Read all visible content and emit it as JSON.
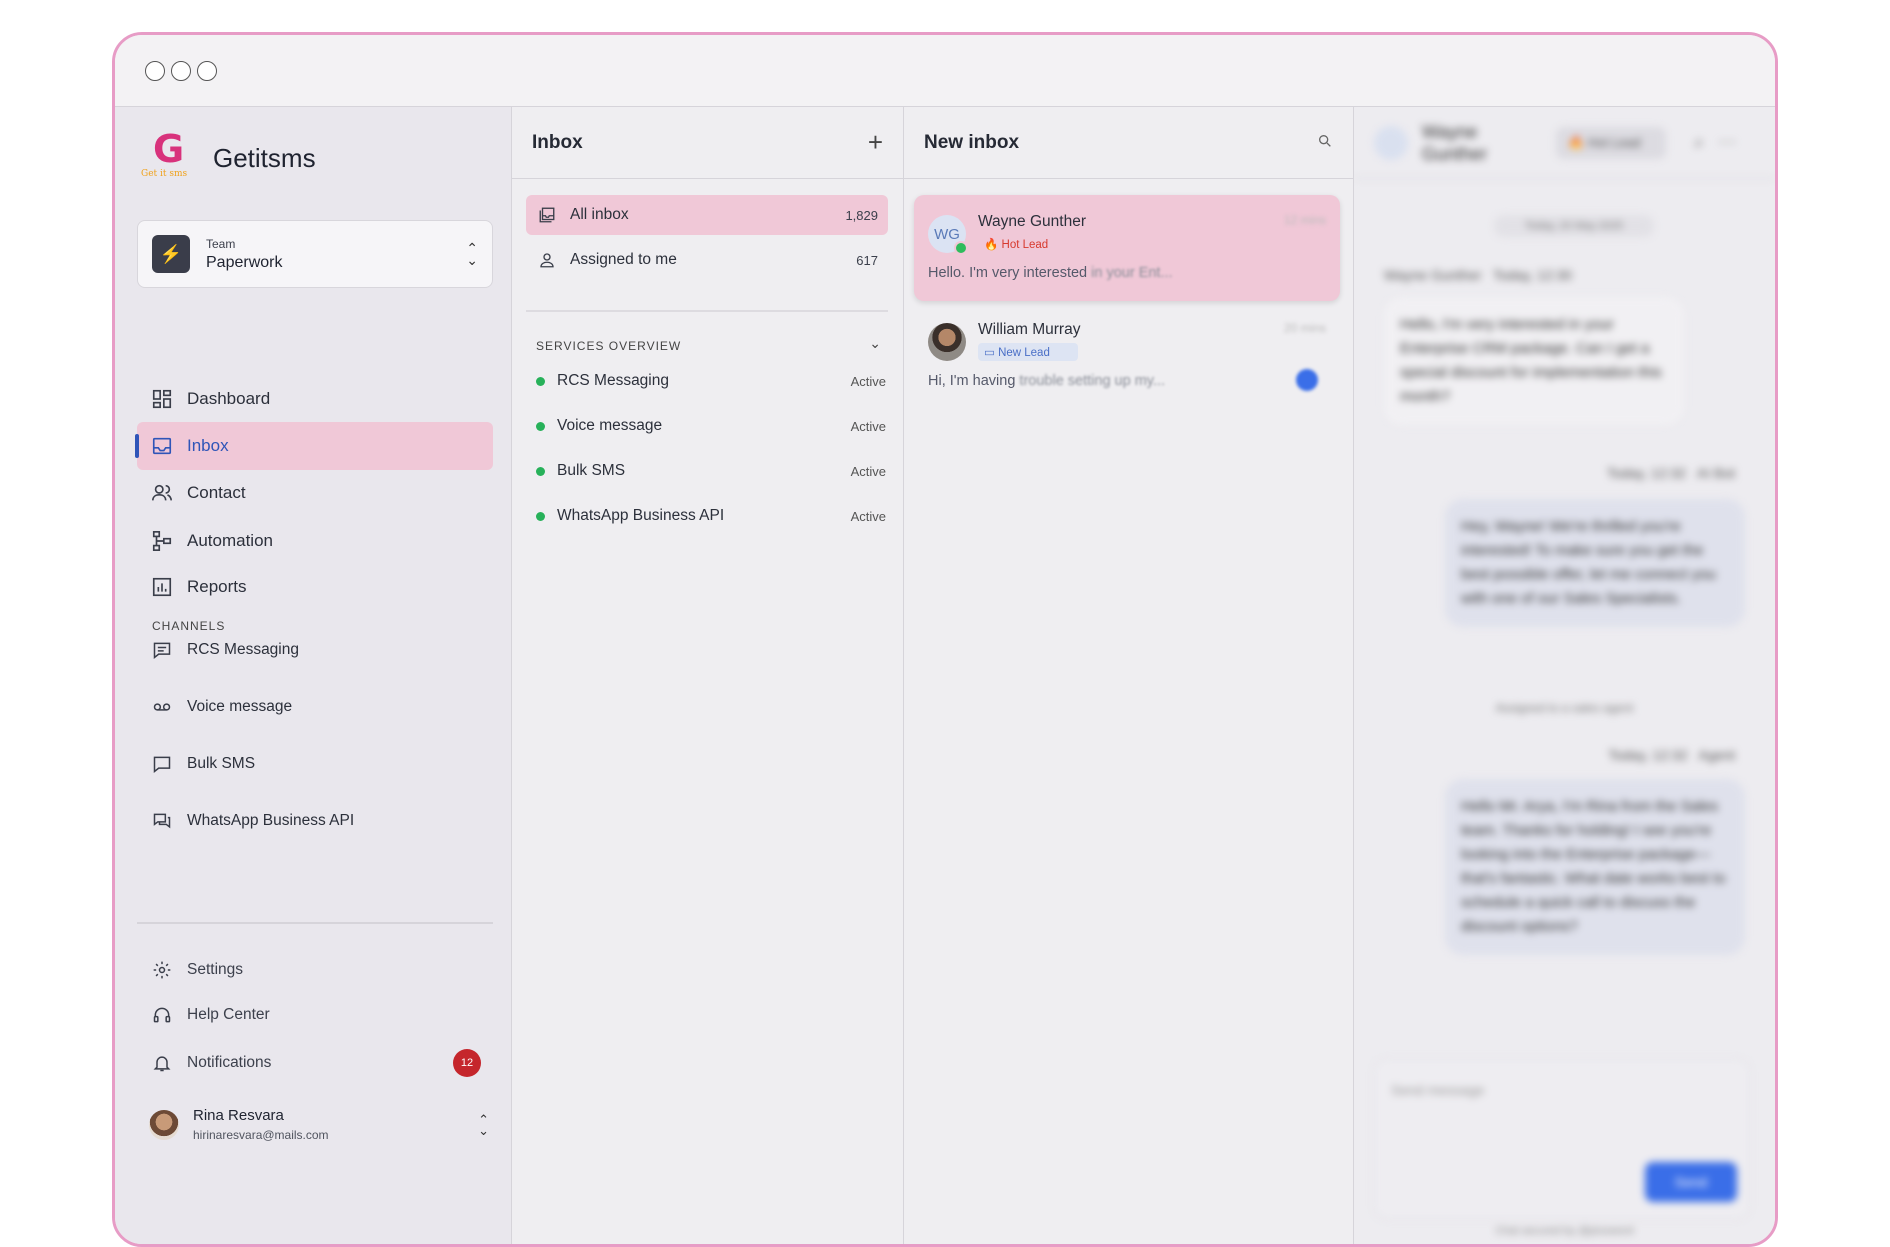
{
  "brand": {
    "name": "Getitsms",
    "logo_text": "Get it sms"
  },
  "team": {
    "label": "Team",
    "name": "Paperwork"
  },
  "nav": [
    {
      "label": "Dashboard",
      "icon": "dashboard-icon"
    },
    {
      "label": "Inbox",
      "icon": "inbox-icon",
      "active": true
    },
    {
      "label": "Contact",
      "icon": "contact-icon"
    },
    {
      "label": "Automation",
      "icon": "automation-icon"
    },
    {
      "label": "Reports",
      "icon": "reports-icon"
    }
  ],
  "channels": {
    "label": "CHANNELS",
    "items": [
      {
        "label": "RCS Messaging",
        "icon": "message-icon"
      },
      {
        "label": "Voice message",
        "icon": "voicemail-icon"
      },
      {
        "label": "Bulk SMS",
        "icon": "sms-icon"
      },
      {
        "label": "WhatsApp Business API",
        "icon": "chat-icon"
      }
    ]
  },
  "bottom_nav": {
    "settings": "Settings",
    "help": "Help Center",
    "notifications": "Notifications",
    "notifications_count": "12"
  },
  "user": {
    "name": "Rina Resvara",
    "email": "hirinaresvara@mails.com"
  },
  "inbox_col": {
    "title": "Inbox",
    "add_icon": "+",
    "filters": [
      {
        "label": "All inbox",
        "count": "1,829",
        "selected": true
      },
      {
        "label": "Assigned to me",
        "count": "617"
      }
    ],
    "services_label": "SERVICES OVERVIEW",
    "services": [
      {
        "name": "RCS Messaging",
        "status": "Active"
      },
      {
        "name": "Voice message",
        "status": "Active"
      },
      {
        "name": "Bulk SMS",
        "status": "Active"
      },
      {
        "name": "WhatsApp Business API",
        "status": "Active"
      }
    ]
  },
  "list_col": {
    "title": "New inbox",
    "conversations": [
      {
        "initials": "WG",
        "name": "Wayne Gunther",
        "tag": "🔥 Hot Lead",
        "time": "12 mins",
        "message_start": "Hello. I'm very interested ",
        "message_end": "in your Ent..."
      },
      {
        "name": "William Murray",
        "tag": "New Lead",
        "time": "20 mins",
        "message_start": "Hi, I'm having ",
        "message_end": "trouble setting up my..."
      }
    ]
  },
  "chat": {
    "contact": "Wayne Gunther",
    "lead": "🔥 Hot Lead",
    "date": "Today, 20 May 2025",
    "sender_in": "Wayne Gunther",
    "time_in": "Today, 12:30",
    "msg_in": "Hello, I'm very interested in your Enterprise CRM package. Can I get a special discount for implementation this month?",
    "time_bot": "Today, 12:32",
    "sender_bot": "AI Bot",
    "msg_bot": "Hey, Wayne! We're thrilled you're interested! To make sure you get the best possible offer, let me connect you with one of our Sales Specialists.",
    "system": "Assigned to a sales agent",
    "time_agent": "Today, 12:32",
    "sender_agent": "Agent",
    "msg_agent": "Hello Mr. Arya, I'm Rina from the Sales team. Thanks for holding! I see you're looking into the Enterprise package—that's fantastic. What date works best to schedule a quick call to discuss the discount options?",
    "composer_placeholder": "Send message",
    "send_label": "Send",
    "secured": "Chat secured by @plusword"
  },
  "colors": {
    "accent": "#2f55b8",
    "selected_bg": "#f0c8d7",
    "frame_border": "#e79cc6",
    "status_green": "#27b15a",
    "badge_red": "#c5262c"
  }
}
